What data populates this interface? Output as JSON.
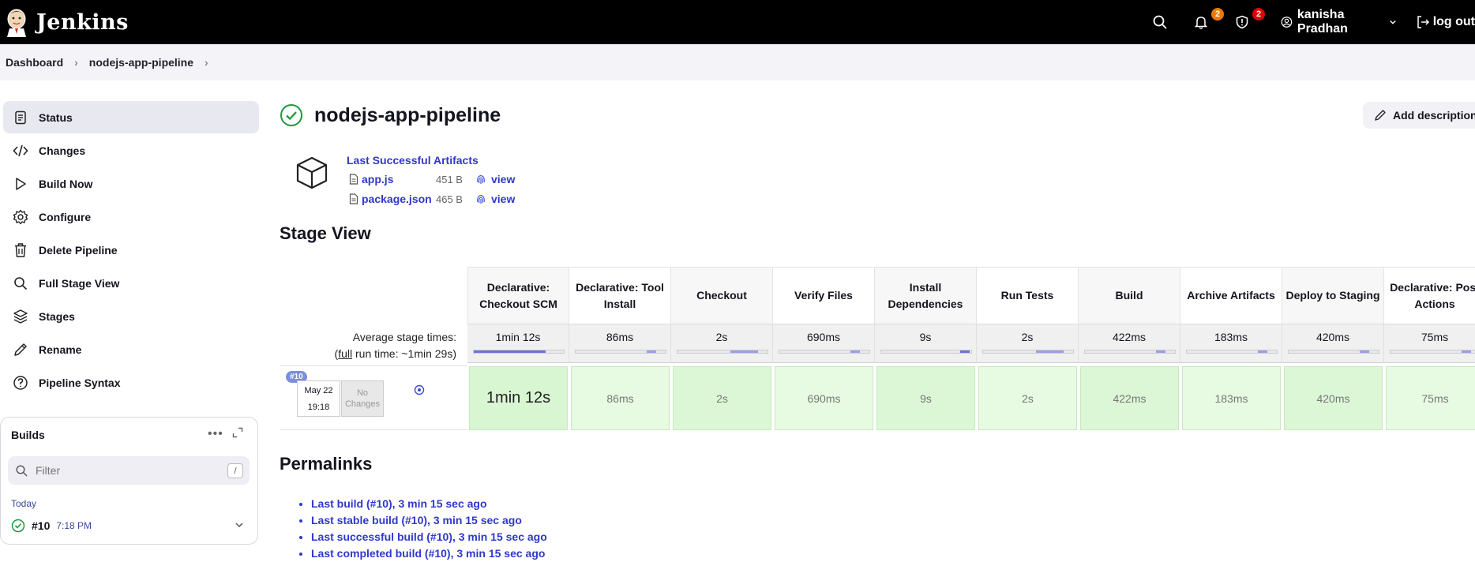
{
  "header": {
    "brand": "Jenkins",
    "notifications_count": "2",
    "security_count": "2",
    "user_name": "kanisha Pradhan",
    "logout_label": "log out",
    "colors": {
      "bg": "#000000",
      "notif_badge": "#f07800",
      "security_badge": "#e00000"
    }
  },
  "breadcrumb": {
    "items": [
      "Dashboard",
      "nodejs-app-pipeline"
    ]
  },
  "sidebar": {
    "items": [
      {
        "label": "Status",
        "icon": "status-icon",
        "active": true
      },
      {
        "label": "Changes",
        "icon": "code-icon"
      },
      {
        "label": "Build Now",
        "icon": "play-icon"
      },
      {
        "label": "Configure",
        "icon": "gear-icon"
      },
      {
        "label": "Delete Pipeline",
        "icon": "trash-icon"
      },
      {
        "label": "Full Stage View",
        "icon": "search-icon"
      },
      {
        "label": "Stages",
        "icon": "layers-icon"
      },
      {
        "label": "Rename",
        "icon": "pencil-icon"
      },
      {
        "label": "Pipeline Syntax",
        "icon": "help-icon"
      }
    ]
  },
  "builds": {
    "title": "Builds",
    "filter_placeholder": "Filter",
    "filter_shortcut": "/",
    "group_label": "Today",
    "items": [
      {
        "number": "#10",
        "time": "7:18 PM",
        "status": "success"
      }
    ]
  },
  "main": {
    "title": "nodejs-app-pipeline",
    "add_description": "Add description",
    "artifacts": {
      "title": "Last Successful Artifacts",
      "files": [
        {
          "name": "app.js",
          "size": "451 B",
          "view": "view"
        },
        {
          "name": "package.json",
          "size": "465 B",
          "view": "view"
        }
      ]
    },
    "stage_view": {
      "title": "Stage View",
      "avg_label_line1": "Average stage times:",
      "avg_label_prefix": "(",
      "avg_label_full": "full",
      "avg_label_suffix": " run time: ~1min 29s)",
      "run": {
        "badge": "#10",
        "date": "May 22",
        "time": "19:18",
        "changes": "No Changes"
      },
      "stages": [
        {
          "name": "Declarative: Checkout SCM",
          "avg": "1min 12s",
          "cell": "1min 12s",
          "fill": 0.8
        },
        {
          "name": "Declarative: Tool Install",
          "avg": "86ms",
          "cell": "86ms",
          "fill": 0.01
        },
        {
          "name": "Checkout",
          "avg": "2s",
          "cell": "2s",
          "fill": 0.03
        },
        {
          "name": "Verify Files",
          "avg": "690ms",
          "cell": "690ms",
          "fill": 0.01
        },
        {
          "name": "Install Dependencies",
          "avg": "9s",
          "cell": "9s",
          "fill": 0.1
        },
        {
          "name": "Run Tests",
          "avg": "2s",
          "cell": "2s",
          "fill": 0.03
        },
        {
          "name": "Build",
          "avg": "422ms",
          "cell": "422ms",
          "fill": 0.01
        },
        {
          "name": "Archive Artifacts",
          "avg": "183ms",
          "cell": "183ms",
          "fill": 0.01
        },
        {
          "name": "Deploy to Staging",
          "avg": "420ms",
          "cell": "420ms",
          "fill": 0.01
        },
        {
          "name": "Declarative: Post Actions",
          "avg": "75ms",
          "cell": "75ms",
          "fill": 0.01
        }
      ]
    },
    "permalinks": {
      "title": "Permalinks",
      "items": [
        "Last build (#10), 3 min 15 sec ago",
        "Last stable build (#10), 3 min 15 sec ago",
        "Last successful build (#10), 3 min 15 sec ago",
        "Last completed build (#10), 3 min 15 sec ago"
      ]
    }
  }
}
